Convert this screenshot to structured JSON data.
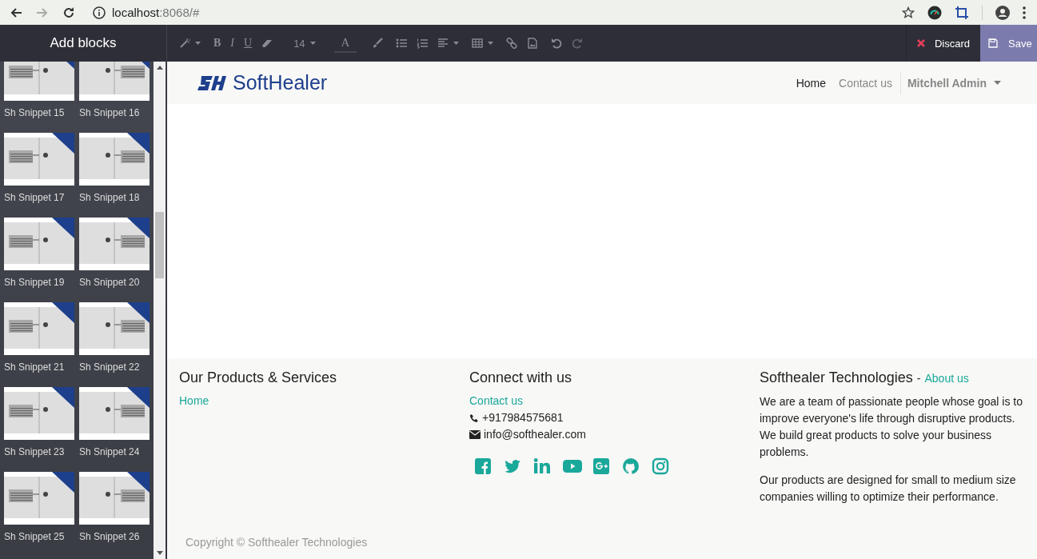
{
  "browser": {
    "nav_buttons": [
      {
        "kind": "back",
        "disabled": false
      },
      {
        "kind": "forward",
        "disabled": true
      },
      {
        "kind": "reload",
        "disabled": false
      }
    ],
    "address": {
      "host": "localhost",
      "rest": ":8068/#"
    }
  },
  "editor_bar": {
    "panel_title": "Add blocks",
    "toolbar": [
      [
        {
          "kind": "wand",
          "dropdown": true
        }
      ],
      [
        {
          "kind": "bold",
          "label": "B"
        },
        {
          "kind": "italic",
          "label": "I"
        },
        {
          "kind": "underline",
          "label": "U"
        },
        {
          "kind": "eraser"
        }
      ],
      [
        {
          "kind": "size",
          "label": "14",
          "dropdown": true
        }
      ],
      [
        {
          "kind": "color",
          "label": "A"
        },
        {
          "kind": "brush"
        }
      ],
      [
        {
          "kind": "ul"
        },
        {
          "kind": "ol"
        },
        {
          "kind": "align",
          "dropdown": true
        }
      ],
      [
        {
          "kind": "table",
          "dropdown": true
        }
      ],
      [
        {
          "kind": "link"
        },
        {
          "kind": "image"
        }
      ],
      [
        {
          "kind": "undo"
        },
        {
          "kind": "redo"
        }
      ]
    ],
    "discard": "Discard",
    "save": "Save"
  },
  "snippets": [
    {
      "label": "Sh Snippet 15",
      "kind": "left"
    },
    {
      "label": "Sh Snippet 16",
      "kind": "right"
    },
    {
      "label": "Sh Snippet 17",
      "kind": "left"
    },
    {
      "label": "Sh Snippet 18",
      "kind": "right"
    },
    {
      "label": "Sh Snippet 19",
      "kind": "left"
    },
    {
      "label": "Sh Snippet 20",
      "kind": "right"
    },
    {
      "label": "Sh Snippet 21",
      "kind": "left"
    },
    {
      "label": "Sh Snippet 22",
      "kind": "right"
    },
    {
      "label": "Sh Snippet 23",
      "kind": "left"
    },
    {
      "label": "Sh Snippet 24",
      "kind": "right"
    },
    {
      "label": "Sh Snippet 25",
      "kind": "left"
    },
    {
      "label": "Sh Snippet 26",
      "kind": "right"
    }
  ],
  "site_header": {
    "logo": "SoftHealer",
    "nav": [
      {
        "label": "Home",
        "selected": true
      },
      {
        "label": "Contact us",
        "selected": false
      }
    ],
    "user": "Mitchell Admin"
  },
  "footer": {
    "columns": [
      {
        "heading": "Our Products & Services",
        "links": [
          "Home"
        ]
      },
      {
        "heading": "Connect with us",
        "links": [
          "Contact us"
        ],
        "phone": "+917984575681",
        "email": "info@softhealer.com",
        "social": [
          {
            "kind": "facebook"
          },
          {
            "kind": "twitter"
          },
          {
            "kind": "linkedin"
          },
          {
            "kind": "youtube"
          },
          {
            "kind": "google-plus"
          },
          {
            "kind": "github"
          },
          {
            "kind": "instagram"
          }
        ]
      },
      {
        "heading": "Softhealer Technologies",
        "heading_separator": "-",
        "heading_link": "About us",
        "paragraphs": [
          "We are a team of passionate people whose goal is to improve everyone's life through disruptive products. We build great products to solve your business problems.",
          "Our products are designed for small to medium size companies willing to optimize their performance."
        ]
      }
    ],
    "copyright": "Copyright © Softhealer Technologies"
  }
}
